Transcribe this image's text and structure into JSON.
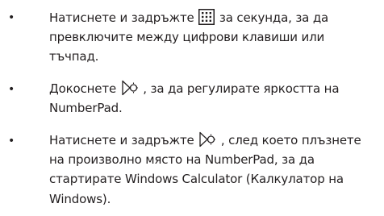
{
  "instructions": [
    {
      "bullet": "•",
      "icon": "keypad-grid-icon",
      "before_icon": "Натиснете и задръжте",
      "after_icon": "за секунда, за да",
      "lines": [
        "превключите между цифрови клавиши или",
        "тъчпад."
      ]
    },
    {
      "bullet": "•",
      "icon": "brightness-swipe-icon",
      "before_icon": "Докоснете",
      "after_icon": ", за да регулирате яркостта на",
      "lines": [
        "NumberPad."
      ]
    },
    {
      "bullet": "•",
      "icon": "brightness-swipe-icon",
      "before_icon": "Натиснете и задръжте",
      "after_icon": ", след което плъзнете",
      "lines": [
        "на произволно място на NumberPad, за да",
        "стартирате Windows Calculator (Калкулатор на",
        "Windows)."
      ]
    }
  ],
  "colors": {
    "text": "#231f20",
    "background": "#ffffff"
  }
}
